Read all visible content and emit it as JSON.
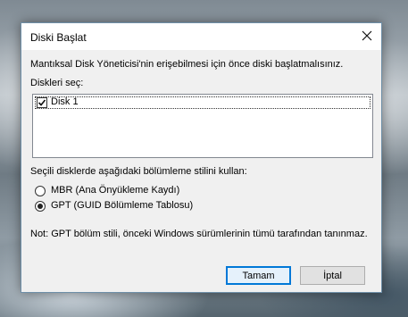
{
  "dialog": {
    "title": "Diski Başlat",
    "intro": "Mantıksal Disk Yöneticisi'nin erişebilmesi için önce diski başlatmalısınız.",
    "select_label": "Diskleri seç:",
    "disks": [
      {
        "label": "Disk 1",
        "checked": true
      }
    ],
    "partition_label": "Seçili disklerde aşağıdaki bölümleme stilini kullan:",
    "options": [
      {
        "label": "MBR (Ana Önyükleme Kaydı)",
        "selected": false
      },
      {
        "label": "GPT (GUID Bölümleme Tablosu)",
        "selected": true
      }
    ],
    "note": "Not: GPT bölüm stili, önceki Windows sürümlerinin tümü tarafından tanınmaz.",
    "ok_label": "Tamam",
    "cancel_label": "İptal"
  },
  "icons": {
    "close": "close-icon",
    "check": "check-icon"
  },
  "colors": {
    "accent": "#0078d7",
    "dialog_bg": "#f0f0f0"
  }
}
